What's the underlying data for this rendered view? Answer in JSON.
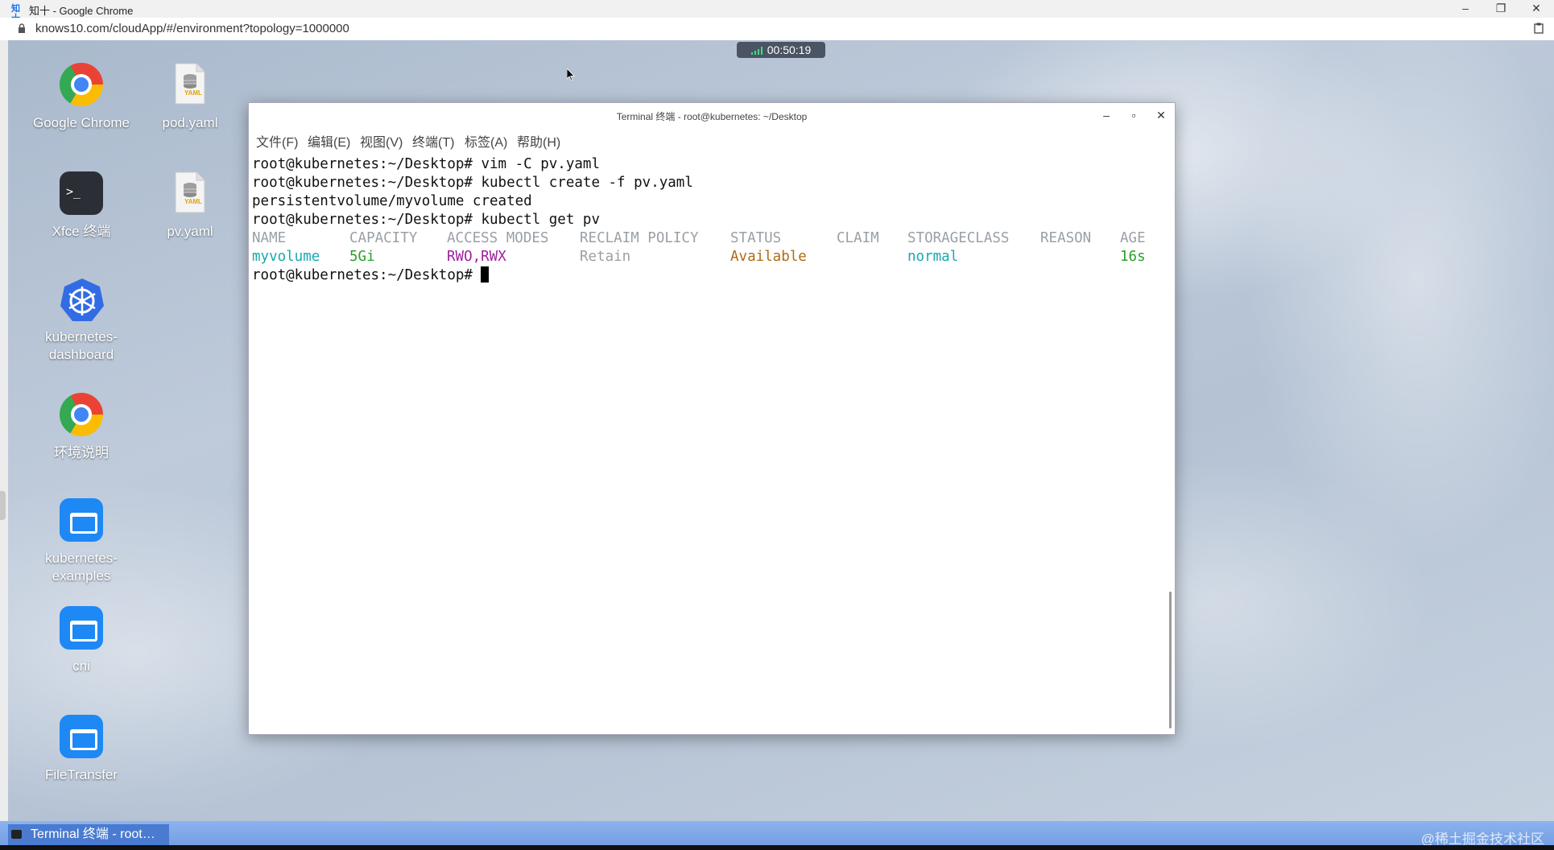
{
  "browser": {
    "window_title": "知十 - Google Chrome",
    "favicon_text": "知十",
    "url": "knows10.com/cloudApp/#/environment?topology=1000000",
    "controls": [
      "–",
      "❐",
      "✕"
    ]
  },
  "session_timer": "00:50:19",
  "desktop_icons": [
    {
      "label": "Google Chrome"
    },
    {
      "label": "pod.yaml"
    },
    {
      "label": "Xfce 终端"
    },
    {
      "label": "pv.yaml"
    },
    {
      "label": "kubernetes-\ndashboard",
      "line1": "kubernetes-",
      "line2": "dashboard"
    },
    {
      "label": "环境说明"
    },
    {
      "label": "kubernetes-\nexamples",
      "line1": "kubernetes-",
      "line2": "examples"
    },
    {
      "label": "cni"
    },
    {
      "label": "FileTransfer"
    }
  ],
  "yaml_badge": "YAML",
  "terminal": {
    "title": "Terminal 终端 - root@kubernetes: ~/Desktop",
    "menu": [
      "文件(F)",
      "编辑(E)",
      "视图(V)",
      "终端(T)",
      "标签(A)",
      "帮助(H)"
    ],
    "prompt": "root@kubernetes:~/Desktop# ",
    "lines": [
      {
        "cmd": "vim -C pv.yaml"
      },
      {
        "cmd": "kubectl create -f pv.yaml"
      },
      {
        "output": "persistentvolume/myvolume created"
      },
      {
        "cmd": "kubectl get pv"
      }
    ],
    "table_headers": [
      "NAME",
      "CAPACITY",
      "ACCESS MODES",
      "RECLAIM POLICY",
      "STATUS",
      "CLAIM",
      "STORAGECLASS",
      "REASON",
      "AGE"
    ],
    "table_row": {
      "name": "myvolume",
      "capacity": "5Gi",
      "access_modes": "RWO,RWX",
      "reclaim_policy": "Retain",
      "status": "Available",
      "claim": "",
      "storageclass": "normal",
      "reason": "",
      "age": "16s"
    }
  },
  "taskbar": {
    "item": "Terminal 终端 - root…"
  },
  "watermark": "@稀土掘金技术社区"
}
